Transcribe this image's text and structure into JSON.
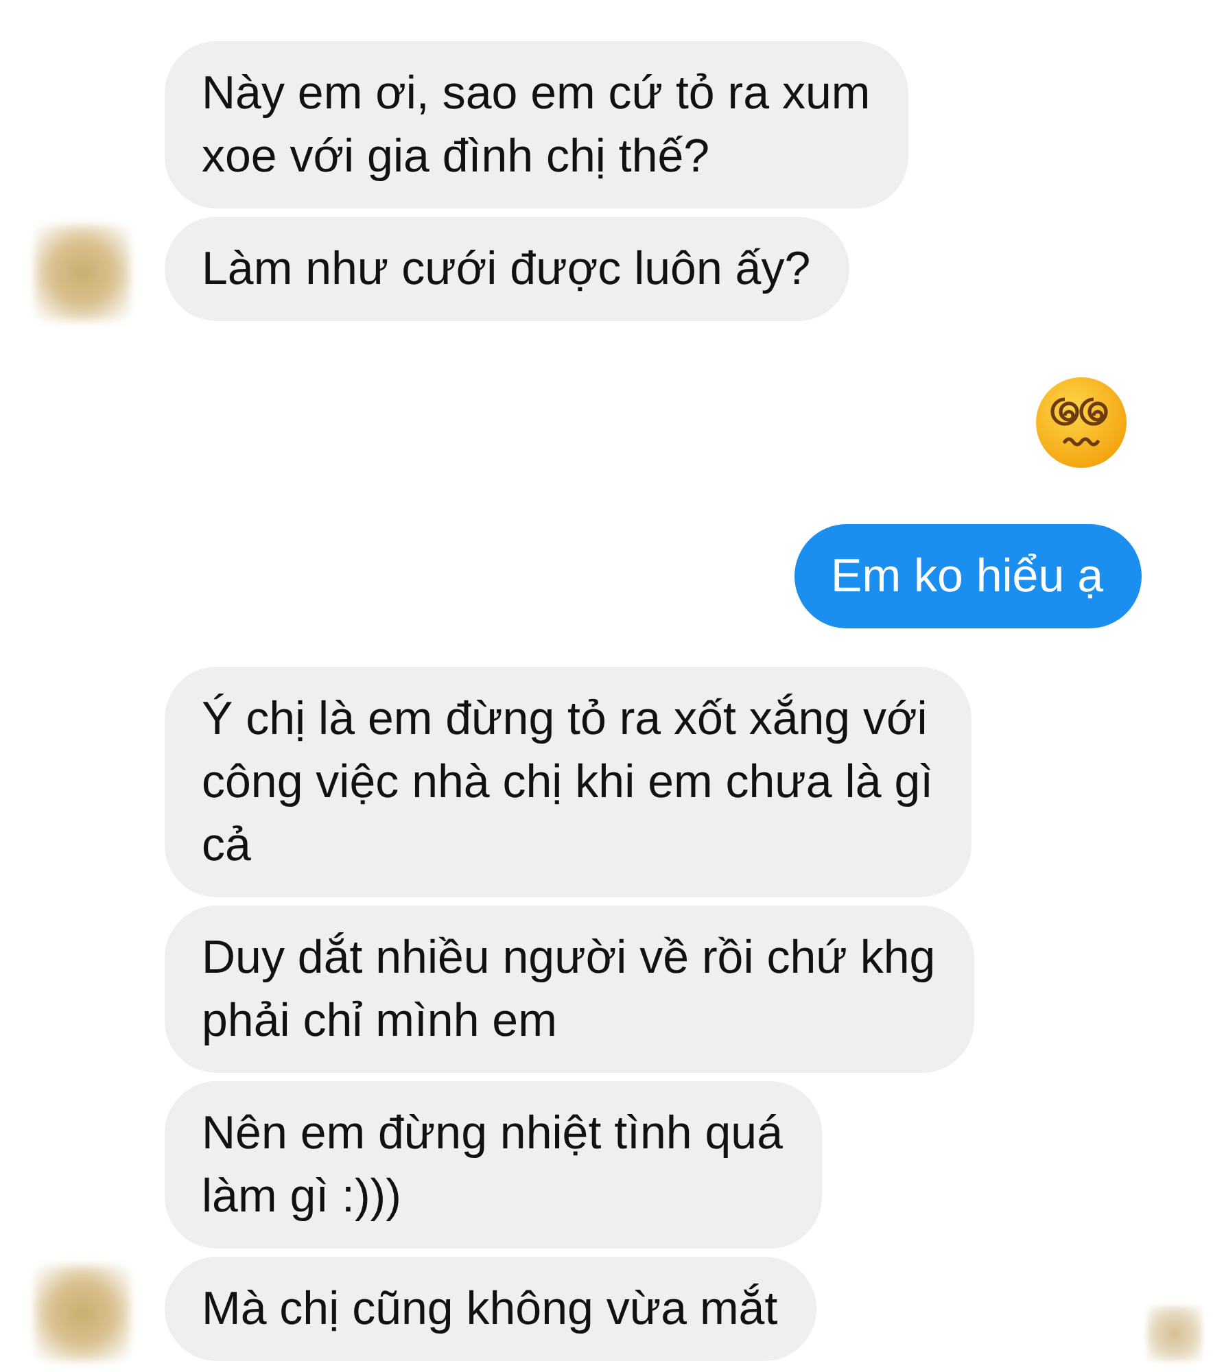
{
  "groups": [
    {
      "outgoing": false,
      "messages": [
        {
          "kind": "text",
          "text": "Này em ơi, sao em cứ tỏ ra xum\nxoe với gia đình chị thế?"
        },
        {
          "kind": "text",
          "text": "Làm như cưới được luôn ấy?"
        }
      ]
    },
    {
      "outgoing": true,
      "messages": [
        {
          "kind": "emoji"
        },
        {
          "kind": "text",
          "text": "Em ko hiểu ạ"
        }
      ]
    },
    {
      "outgoing": false,
      "messages": [
        {
          "kind": "text",
          "text": "Ý chị là em đừng tỏ ra xốt xắng với\ncông việc nhà chị khi em chưa là gì\ncả"
        },
        {
          "kind": "text",
          "text": "Duy dắt nhiều người về rồi chứ khg\nphải chỉ mình em"
        },
        {
          "kind": "text",
          "text": "Nên em đừng nhiệt tình quá\nlàm gì :)))"
        },
        {
          "kind": "text",
          "text": "Mà chị cũng không vừa mắt"
        }
      ]
    }
  ],
  "seen": true
}
